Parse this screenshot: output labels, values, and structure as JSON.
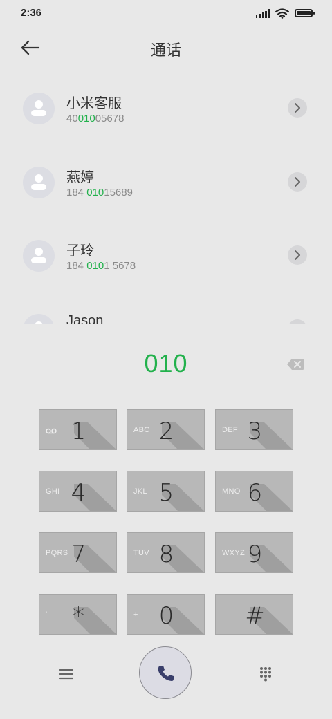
{
  "status": {
    "time": "2:36"
  },
  "header": {
    "title": "通话"
  },
  "contacts": [
    {
      "name": "小米客服",
      "number_parts": [
        "40",
        "010",
        "05678"
      ]
    },
    {
      "name": "燕婷",
      "number_parts": [
        "184 ",
        "010",
        "15689"
      ]
    },
    {
      "name": "子玲",
      "number_parts": [
        "184 ",
        "010",
        "1 5678"
      ]
    },
    {
      "name": "Jason"
    }
  ],
  "dialer": {
    "digits": "010"
  },
  "keypad": {
    "keys": [
      {
        "digit": "1",
        "letters": ""
      },
      {
        "digit": "2",
        "letters": "ABC"
      },
      {
        "digit": "3",
        "letters": "DEF"
      },
      {
        "digit": "4",
        "letters": "GHI"
      },
      {
        "digit": "5",
        "letters": "JKL"
      },
      {
        "digit": "6",
        "letters": "MNO"
      },
      {
        "digit": "7",
        "letters": "PQRS"
      },
      {
        "digit": "8",
        "letters": "TUV"
      },
      {
        "digit": "9",
        "letters": "WXYZ"
      },
      {
        "digit": "*",
        "letters": "'"
      },
      {
        "digit": "0",
        "letters": "+"
      },
      {
        "digit": "#",
        "letters": ""
      }
    ]
  },
  "icons": {
    "back": "back-arrow-icon",
    "detail": "chevron-right-icon",
    "backspace": "backspace-icon",
    "voicemail": "voicemail-icon",
    "menu": "menu-icon",
    "call": "phone-icon",
    "dialpad": "dialpad-icon"
  },
  "colors": {
    "highlight": "#22b14c",
    "background": "#e8e8e8",
    "key": "#b8b8b8"
  }
}
